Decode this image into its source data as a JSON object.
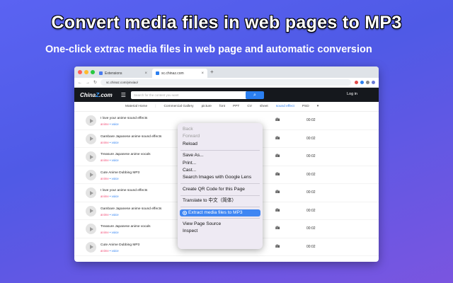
{
  "hero": {
    "title": "Convert media files in web pages to MP3",
    "subtitle": "One-click extrac media files in web page and automatic conversion"
  },
  "browser": {
    "tabs": [
      {
        "label": "Extensions",
        "close": "×"
      },
      {
        "label": "sc.chinaz.com",
        "close": "×"
      }
    ],
    "new_tab": "+",
    "url": "sc.chinaz.com/yinxiao/",
    "window_dots": [
      "#ff5f57",
      "#febc2e",
      "#28c840"
    ]
  },
  "site": {
    "logo_main": "China",
    "logo_accent": "Z",
    "logo_tail": ".com",
    "search_placeholder": "Search for the content you want",
    "search_btn": "⌕",
    "login": "Log in",
    "nav": [
      {
        "label": "Material Home"
      },
      {
        "label": "Commercial Gallery"
      },
      {
        "label": "picture"
      },
      {
        "label": "font"
      },
      {
        "label": "PPT"
      },
      {
        "label": "CV"
      },
      {
        "label": "sheet"
      },
      {
        "label": "sound effect",
        "active": true
      },
      {
        "label": "PSD"
      },
      {
        "label": "▾"
      }
    ]
  },
  "rows": [
    {
      "title": "I love your anime sound effects",
      "tag1": "anime",
      "tag2": "voice",
      "duration": "00:02"
    },
    {
      "title": "Gambare Japanese anime sound effects",
      "tag1": "anime",
      "tag2": "voice",
      "duration": "00:02"
    },
    {
      "title": "Treasure Japanese anime vocals",
      "tag1": "anime",
      "tag2": "voice",
      "duration": "00:02"
    },
    {
      "title": "Cute Anime Dubbing MP3",
      "tag1": "anime",
      "tag2": "voice",
      "duration": "00:02"
    },
    {
      "title": "I love your anime sound effects",
      "tag1": "anime",
      "tag2": "voice",
      "duration": "00:02"
    },
    {
      "title": "Gambare Japanese anime sound effects",
      "tag1": "anime",
      "tag2": "voice",
      "duration": "00:02"
    },
    {
      "title": "Treasure Japanese anime vocals",
      "tag1": "anime",
      "tag2": "voice",
      "duration": "00:02"
    },
    {
      "title": "Cute Anime Dubbing MP3",
      "tag1": "anime",
      "tag2": "voice",
      "duration": "00:02"
    }
  ],
  "wave_glyph": "ıllıı",
  "context_menu": {
    "back": "Back",
    "forward": "Forward",
    "reload": "Reload",
    "save_as": "Save As...",
    "print": "Print...",
    "cast": "Cast...",
    "search_lens": "Search Images with Google Lens",
    "qr": "Create QR Code for this Page",
    "translate": "Translate to 中文（简体）",
    "extract": "Extract media files to MP3",
    "view_source": "View Page Source",
    "inspect": "Inspect"
  }
}
